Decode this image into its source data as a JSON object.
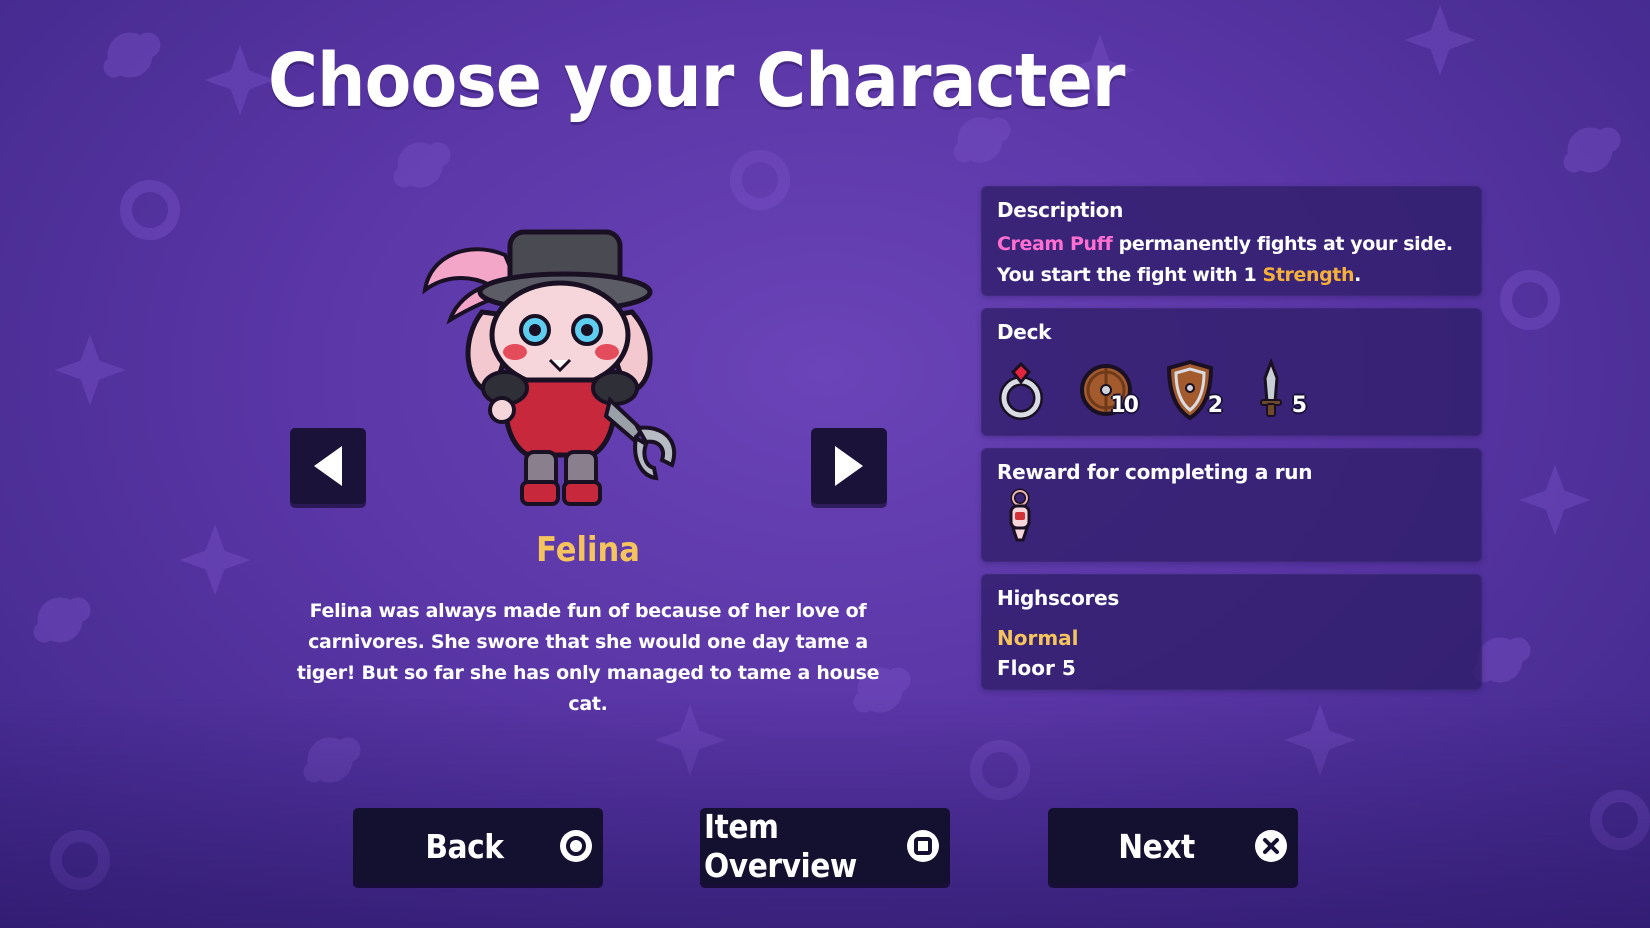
{
  "screen": {
    "title": "Choose your Character"
  },
  "character": {
    "name": "Felina",
    "story": "Felina was always made fun of because of her love of carnivores. She swore that she would one day tame a tiger! But so far she has only managed to tame a house cat.",
    "portrait_icon": "felina-bunny-tophat-portrait"
  },
  "navigation": {
    "prev_icon": "left-arrow-icon",
    "next_icon": "right-arrow-icon"
  },
  "description_panel": {
    "title": "Description",
    "companion": "Cream Puff",
    "text_part1": " permanently fights at your side. You start the fight with 1 ",
    "keyword": "Strength",
    "text_part2": "."
  },
  "deck_panel": {
    "title": "Deck",
    "items": [
      {
        "icon": "ruby-ring-icon",
        "count": ""
      },
      {
        "icon": "round-wooden-shield-icon",
        "count": "10"
      },
      {
        "icon": "kite-shield-icon",
        "count": "2"
      },
      {
        "icon": "dagger-icon",
        "count": "5"
      }
    ]
  },
  "reward_panel": {
    "title": "Reward for completing a run",
    "item_icon": "keychain-charm-icon"
  },
  "highscores_panel": {
    "title": "Highscores",
    "mode": "Normal",
    "floor": "Floor 5"
  },
  "buttons": {
    "back": {
      "label": "Back",
      "glyph": "circle-button-icon"
    },
    "item_overview": {
      "label": "Item Overview",
      "glyph": "square-button-icon"
    },
    "next": {
      "label": "Next",
      "glyph": "cross-button-icon"
    }
  },
  "colors": {
    "background": "#5a36a6",
    "panel": "#2e1e69",
    "button": "#14102f",
    "name_gold": "#f5c45c",
    "highlight_pink": "#ff6fd1",
    "highlight_orange": "#f5b03a"
  }
}
